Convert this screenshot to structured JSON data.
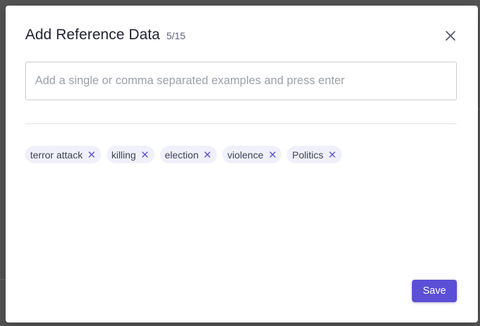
{
  "modal": {
    "title": "Add Reference Data",
    "count": "5/15",
    "input": {
      "value": "",
      "placeholder": "Add a single or comma separated examples and press enter"
    },
    "tags": [
      {
        "label": "terror attack"
      },
      {
        "label": "killing"
      },
      {
        "label": "election"
      },
      {
        "label": "violence"
      },
      {
        "label": "Politics"
      }
    ],
    "save_label": "Save",
    "icons": {
      "close": "close-icon",
      "tag_remove": "close-icon"
    }
  },
  "colors": {
    "accent": "#5b4fd6",
    "tag_background": "#eff0fa",
    "tag_remove": "#5b4fd6",
    "overlay": "#545454"
  }
}
